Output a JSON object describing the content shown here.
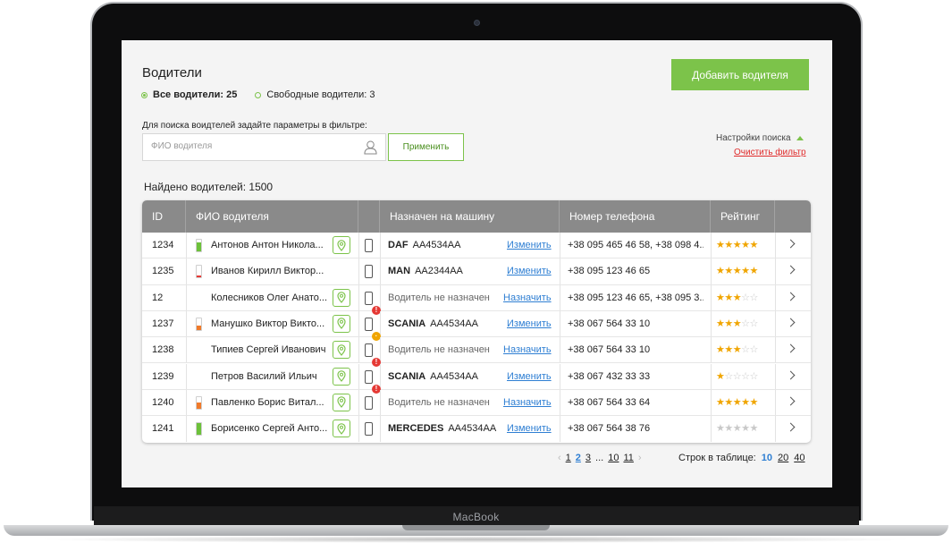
{
  "device": {
    "brand": "MacBook"
  },
  "page": {
    "title": "Водители",
    "filters": [
      {
        "label": "Все водители: 25",
        "selected": true
      },
      {
        "label": "Свободные водители: 3",
        "selected": false
      }
    ],
    "add_button": "Добавить водителя",
    "filter_hint": "Для поиска воидтелей задайте параметры в фильтре:",
    "search_placeholder": "ФИО водителя",
    "apply_button": "Применить",
    "search_settings": "Настройки поиска",
    "clear_filter": "Очистить фильтр",
    "found": "Найдено водителей: 1500"
  },
  "colors": {
    "accent": "#7cc34a",
    "header": "#8a8a8a",
    "link": "#2f7fd3",
    "danger": "#e02b2b",
    "star": "#f0a500",
    "battery_green": "#6cc13a",
    "battery_orange": "#f07a2a",
    "battery_red": "#e53935"
  },
  "table": {
    "columns": [
      "ID",
      "ФИО водителя",
      "",
      "Назначен на машину",
      "Номер телефона",
      "Рейтинг"
    ],
    "rows": [
      {
        "id": "1234",
        "name": "Антонов Антон Никола...",
        "battery": {
          "level": 0.8,
          "color": "#6cc13a"
        },
        "has_pin": true,
        "phone_status": "none",
        "truck_brand": "DAF",
        "truck_plate": "АА4534АА",
        "unassigned": "",
        "action": "Изменить",
        "phone": "+38 095 465 46 58, +38 098 4...",
        "rating": 5
      },
      {
        "id": "1235",
        "name": "Иванов Кирилл Виктор...",
        "battery": {
          "level": 0.15,
          "color": "#e53935"
        },
        "has_pin": false,
        "phone_status": "none",
        "truck_brand": "MAN",
        "truck_plate": "АА2344АА",
        "unassigned": "",
        "action": "Изменить",
        "phone": "+38 095 123 46 65",
        "rating": 5
      },
      {
        "id": "12",
        "name": "Колесников Олег Анато...",
        "battery": null,
        "has_pin": true,
        "phone_status": "error",
        "truck_brand": "",
        "truck_plate": "",
        "unassigned": "Водитель не назначен",
        "action": "Назначить",
        "phone": "+38 095 123 46 65, +38 095 3...",
        "rating": 3
      },
      {
        "id": "1237",
        "name": "Манушко Виктор Викто...",
        "battery": {
          "level": 0.4,
          "color": "#f07a2a"
        },
        "has_pin": true,
        "phone_status": "warning",
        "truck_brand": "SCANIA",
        "truck_plate": "АА4534АА",
        "unassigned": "",
        "action": "Изменить",
        "phone": "+38 067 564 33 10",
        "rating": 3
      },
      {
        "id": "1238",
        "name": "Типиев Сергей Иванович",
        "battery": null,
        "has_pin": true,
        "phone_status": "error",
        "truck_brand": "",
        "truck_plate": "",
        "unassigned": "Водитель не назначен",
        "action": "Назначить",
        "phone": "+38 067 564 33 10",
        "rating": 3
      },
      {
        "id": "1239",
        "name": "Петров Василий Ильич",
        "battery": null,
        "has_pin": true,
        "phone_status": "error",
        "truck_brand": "SCANIA",
        "truck_plate": "АА4534АА",
        "unassigned": "",
        "action": "Изменить",
        "phone": "+38 067 432 33 33",
        "rating": 1
      },
      {
        "id": "1240",
        "name": "Павленко Борис Витал...",
        "battery": {
          "level": 0.55,
          "color": "#f07a2a"
        },
        "has_pin": true,
        "phone_status": "none",
        "truck_brand": "",
        "truck_plate": "",
        "unassigned": "Водитель не назначен",
        "action": "Назначить",
        "phone": "+38 067 564 33 64",
        "rating": 5
      },
      {
        "id": "1241",
        "name": "Борисенко Сергей Анто...",
        "battery": {
          "level": 1.0,
          "color": "#6cc13a"
        },
        "has_pin": true,
        "phone_status": "none",
        "truck_brand": "MERCEDES",
        "truck_plate": "АА4534АА",
        "unassigned": "",
        "action": "Изменить",
        "phone": "+38 067 564 38 76",
        "rating": 0
      }
    ]
  },
  "pagination": {
    "prev": "‹",
    "pages": [
      "1",
      "2",
      "3",
      "...",
      "10",
      "11"
    ],
    "current": "2",
    "next": "›",
    "rows_label": "Строк в таблице:",
    "rows_options": [
      "10",
      "20",
      "40"
    ],
    "rows_current": "10"
  }
}
